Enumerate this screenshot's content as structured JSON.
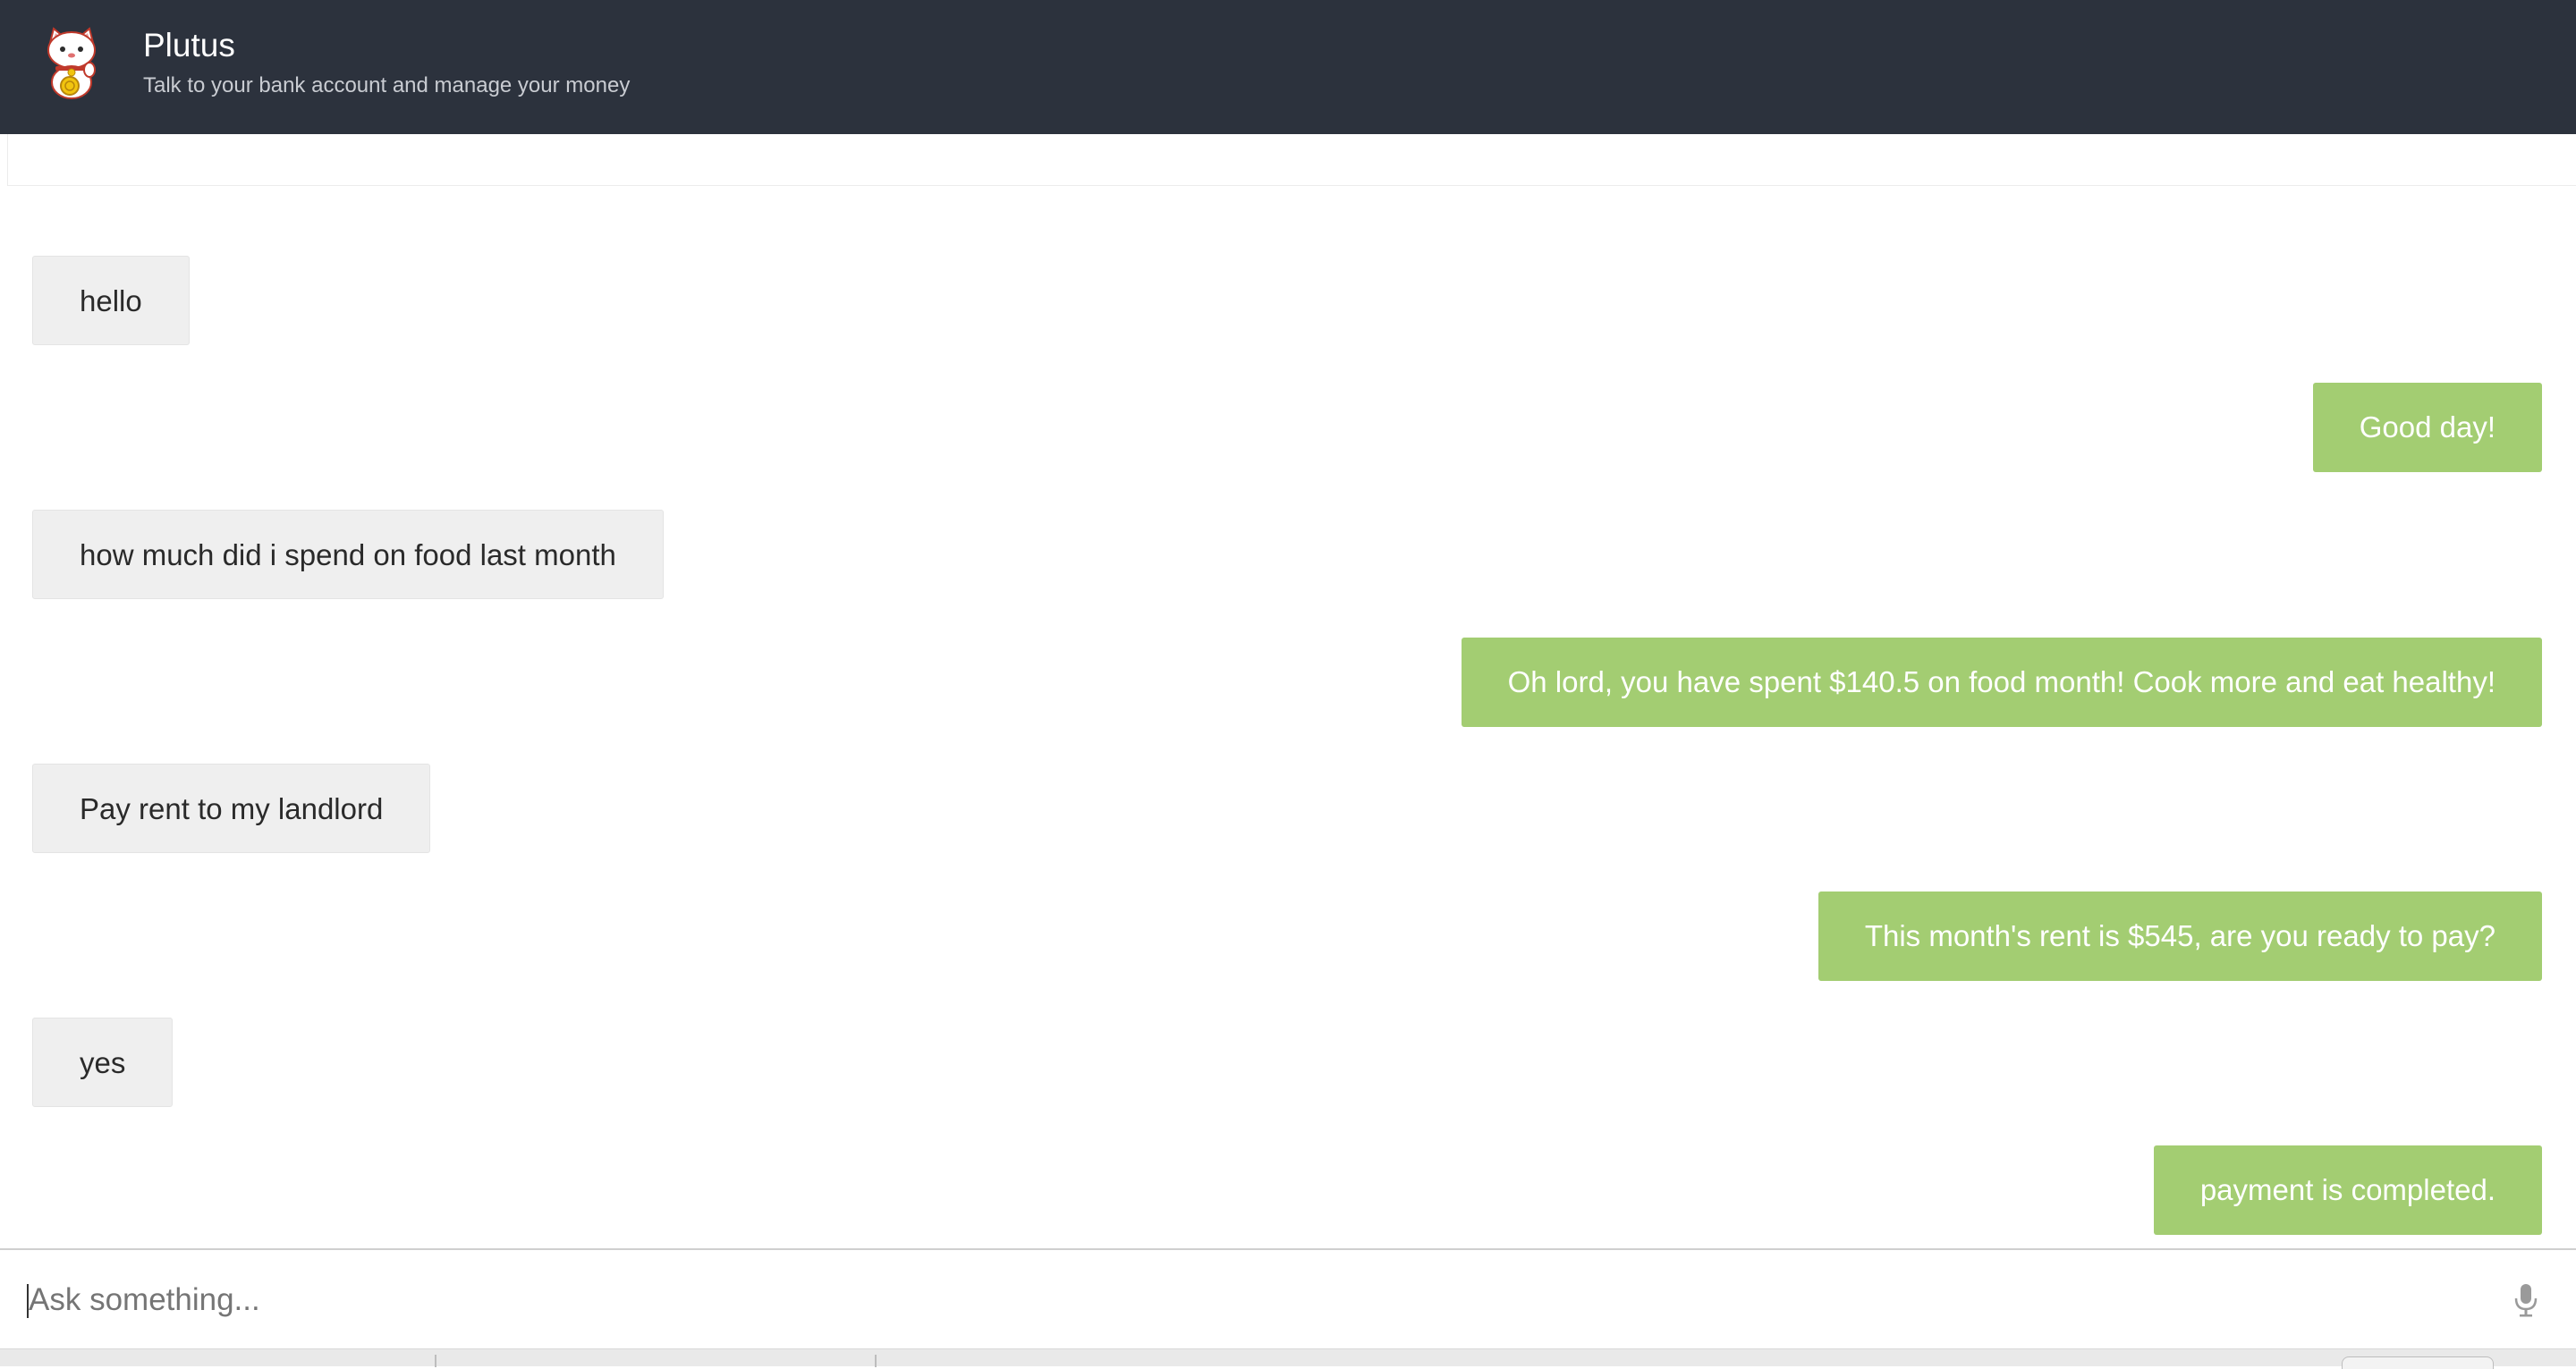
{
  "header": {
    "title": "Plutus",
    "subtitle": "Talk to your bank account and manage your money",
    "logo_icon": "lucky-cat-icon"
  },
  "messages": [
    {
      "role": "user",
      "text": "hello"
    },
    {
      "role": "bot",
      "text": "Good day!"
    },
    {
      "role": "user",
      "text": "how much did i spend on food last month"
    },
    {
      "role": "bot",
      "text": "Oh lord, you have spent $140.5 on food month! Cook more and eat healthy!"
    },
    {
      "role": "user",
      "text": "Pay rent to my landlord"
    },
    {
      "role": "bot",
      "text": "This month's rent is $545, are you ready to pay?"
    },
    {
      "role": "user",
      "text": "yes"
    },
    {
      "role": "bot",
      "text": "payment is completed."
    }
  ],
  "input": {
    "placeholder": "Ask something...",
    "value": "",
    "mic_icon": "microphone-icon"
  },
  "colors": {
    "header_bg": "#2c323d",
    "user_bubble": "#efefef",
    "bot_bubble": "#a3cd72"
  }
}
